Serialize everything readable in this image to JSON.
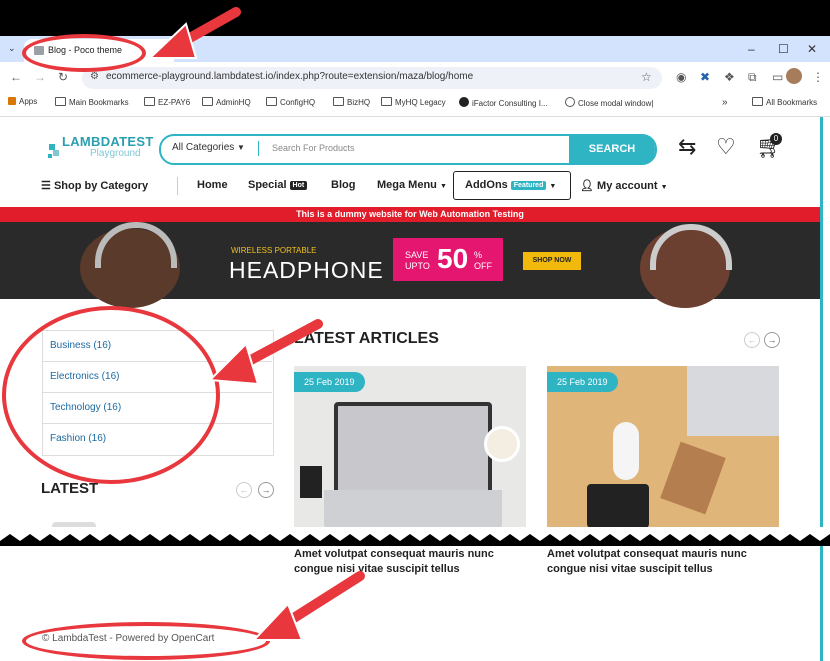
{
  "browser": {
    "tab_title": "Blog - Poco theme",
    "url": "ecommerce-playground.lambdatest.io/index.php?route=extension/maza/blog/home",
    "bookmarks": [
      "Apps",
      "Main Bookmarks",
      "EZ-PAY6",
      "AdminHQ",
      "ConfigHQ",
      "BizHQ",
      "MyHQ Legacy",
      "iFactor Consulting I...",
      "Close modal window|"
    ],
    "all_bookmarks": "All Bookmarks"
  },
  "header": {
    "logo_text": "LAMBDATEST",
    "logo_sub": "Playground",
    "category_select": "All Categories",
    "search_placeholder": "Search For Products",
    "search_button": "SEARCH",
    "cart_count": "0"
  },
  "nav": {
    "shop_by_category": "Shop by Category",
    "home": "Home",
    "special": "Special",
    "hot_badge": "Hot",
    "blog": "Blog",
    "mega_menu": "Mega Menu",
    "addons": "AddOns",
    "featured_badge": "Featured",
    "my_account": "My account"
  },
  "notice": "This is a dummy website for Web Automation Testing",
  "banner": {
    "kicker": "WIRELESS PORTABLE",
    "title": "HEADPHONE",
    "save_line1": "SAVE",
    "save_line2": "UPTO",
    "discount": "50",
    "percent": "%",
    "off": "OFF",
    "cta": "SHOP NOW"
  },
  "sidebar": {
    "categories": [
      {
        "label": "Business (16)"
      },
      {
        "label": "Electronics (16)"
      },
      {
        "label": "Technology (16)"
      },
      {
        "label": "Fashion (16)"
      }
    ],
    "latest_heading": "LATEST"
  },
  "main": {
    "heading": "LATEST ARTICLES",
    "articles": [
      {
        "date": "25 Feb 2019",
        "title": "Amet volutpat consequat mauris nunc congue nisi vitae suscipit tellus"
      },
      {
        "date": "25 Feb 2019",
        "title": "Amet volutpat consequat mauris nunc congue nisi vitae suscipit tellus"
      }
    ]
  },
  "footer": "© LambdaTest - Powered by OpenCart",
  "colors": {
    "accent": "#2fb4c4",
    "notice_bar": "#e11d2b",
    "annotation": "#e8373d"
  }
}
